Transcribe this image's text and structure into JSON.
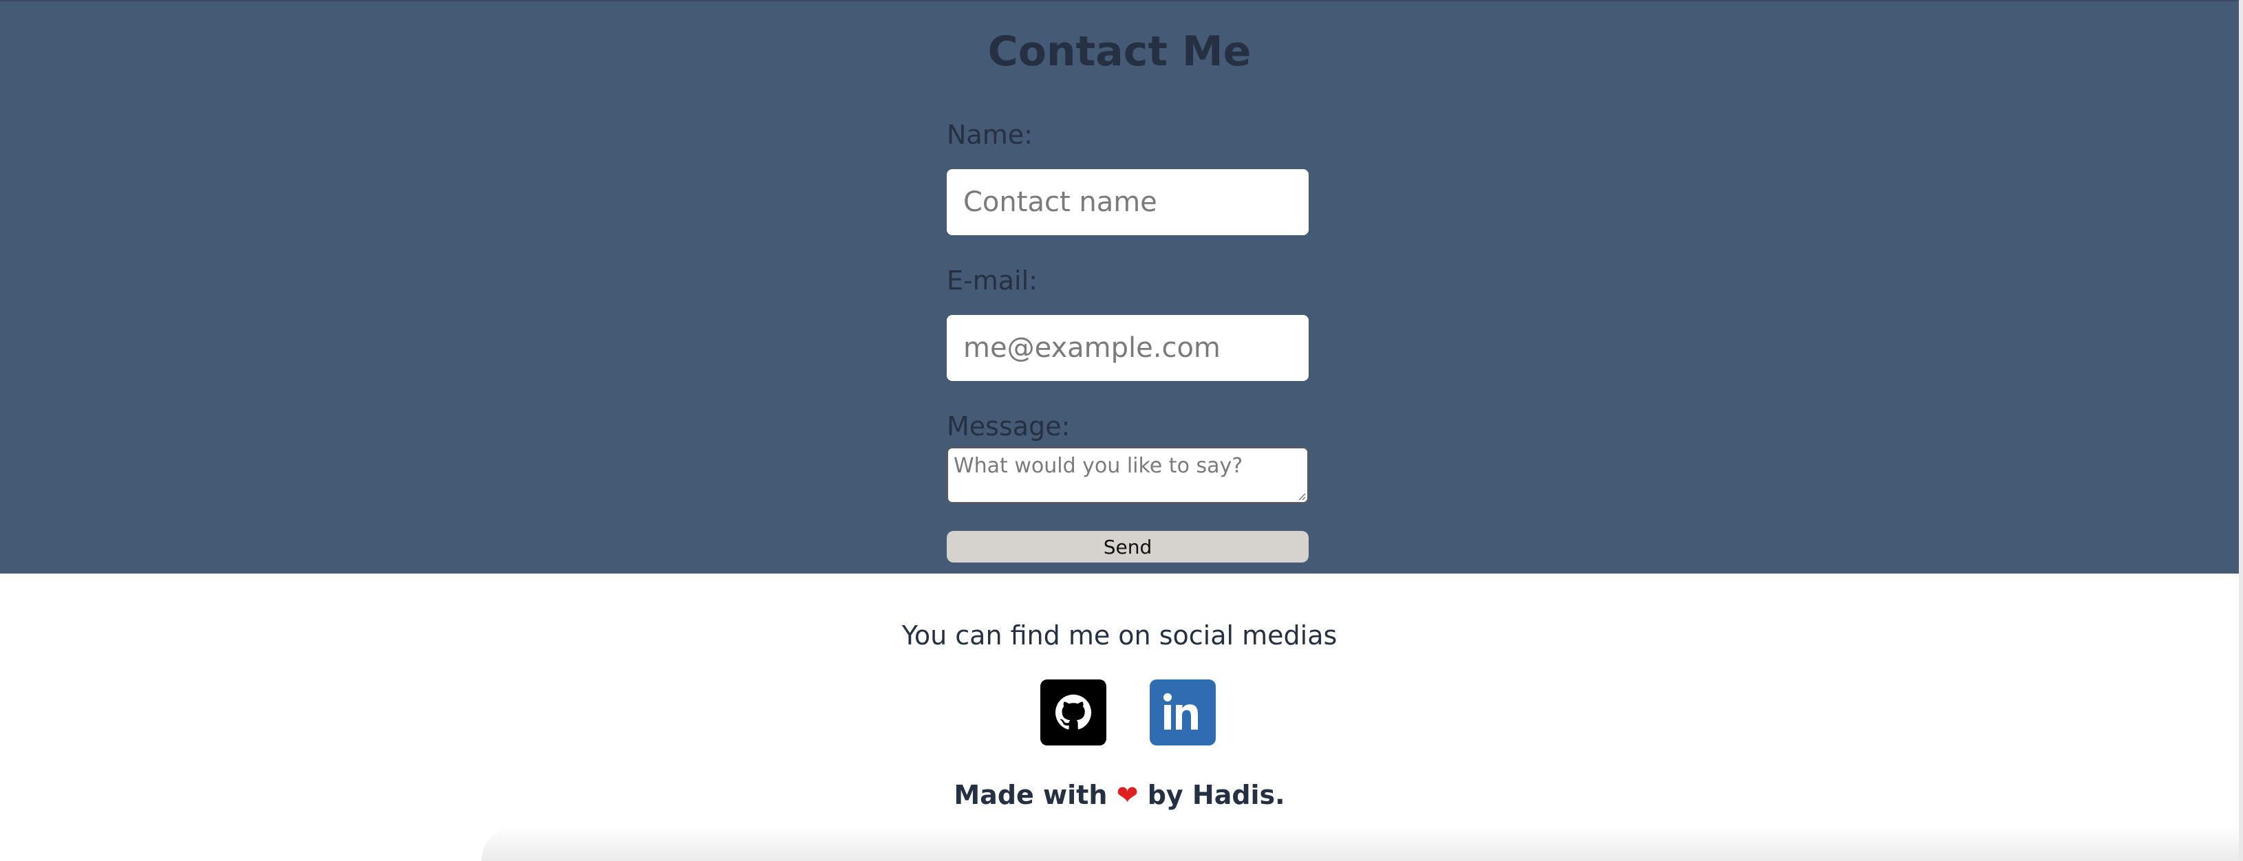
{
  "contact": {
    "title": "Contact Me",
    "name_label": "Name:",
    "name_placeholder": "Contact name",
    "email_label": "E-mail:",
    "email_placeholder": "me@example.com",
    "message_label": "Message:",
    "message_placeholder": "What would you like to say?",
    "send_label": "Send"
  },
  "social": {
    "text": "You can find me on social medias",
    "icons": [
      "github-icon",
      "linkedin-icon"
    ]
  },
  "footer": {
    "made_with": "Made with",
    "heart": "❤",
    "by": "by Hadis."
  },
  "colors": {
    "section_bg": "#455a74",
    "text": "#263043",
    "send_button": "#d6d2ce",
    "linkedin": "#2f6cb2",
    "github": "#000000"
  }
}
